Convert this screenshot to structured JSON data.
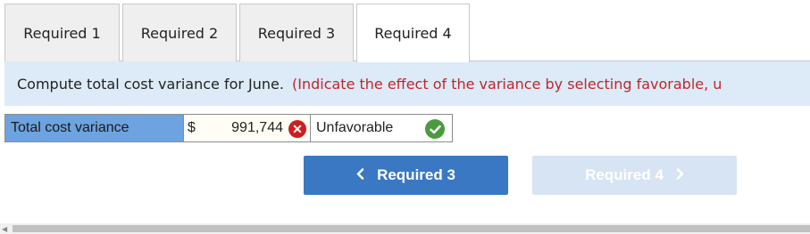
{
  "tabs": [
    {
      "label": "Required 1",
      "active": false
    },
    {
      "label": "Required 2",
      "active": false
    },
    {
      "label": "Required 3",
      "active": false
    },
    {
      "label": "Required 4",
      "active": true
    }
  ],
  "instruction": {
    "text": "Compute total cost variance for June.",
    "note": "(Indicate the effect of the variance by selecting favorable, u"
  },
  "answer_row": {
    "label": "Total cost variance",
    "currency": "$",
    "amount": "991,744",
    "amount_status": "incorrect",
    "effect": "Unfavorable",
    "effect_status": "correct"
  },
  "nav": {
    "prev_label": "Required 3",
    "next_label": "Required 4",
    "next_enabled": false
  },
  "icons": {
    "prev": "chevron-left-icon",
    "next": "chevron-right-icon",
    "incorrect": "x-circle-icon",
    "correct": "check-circle-icon"
  },
  "colors": {
    "instruction_bg": "#dcebf7",
    "note_text": "#c0262b",
    "label_cell_bg": "#6da3e0",
    "primary_button": "#3a78c3",
    "disabled_button": "#d6e4f3",
    "incorrect_mark": "#cc1f1f",
    "correct_mark": "#4a9b3e"
  }
}
